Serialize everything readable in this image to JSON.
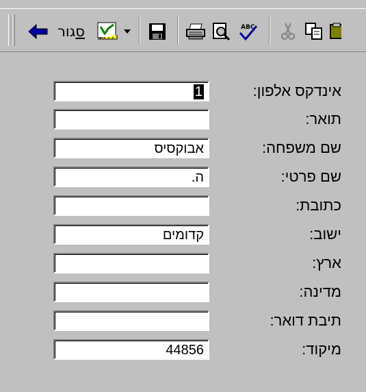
{
  "toolbar": {
    "close_label": "סגור",
    "close_accel": "ס",
    "close_rest": "גור"
  },
  "fields": [
    {
      "label": "אינדקס אלפון:",
      "value": "1",
      "selected": true
    },
    {
      "label": "תואר:",
      "value": ""
    },
    {
      "label": "שם משפחה:",
      "value": "אבוקסיס"
    },
    {
      "label": "שם פרטי:",
      "value": "ה."
    },
    {
      "label": "כתובת:",
      "value": ""
    },
    {
      "label": "ישוב:",
      "value": "קדומים"
    },
    {
      "label": "ארץ:",
      "value": ""
    },
    {
      "label": "מדינה:",
      "value": ""
    },
    {
      "label": "תיבת דואר:",
      "value": ""
    },
    {
      "label": "מיקוד:",
      "value": "44856"
    }
  ],
  "colors": {
    "window_bg": "#c0c0c0",
    "field_bg": "#ffffff",
    "selection_bg": "#000000",
    "arrow_blue": "#0000a0",
    "checkmark_green": "#008000",
    "spell_red": "#c00000"
  }
}
